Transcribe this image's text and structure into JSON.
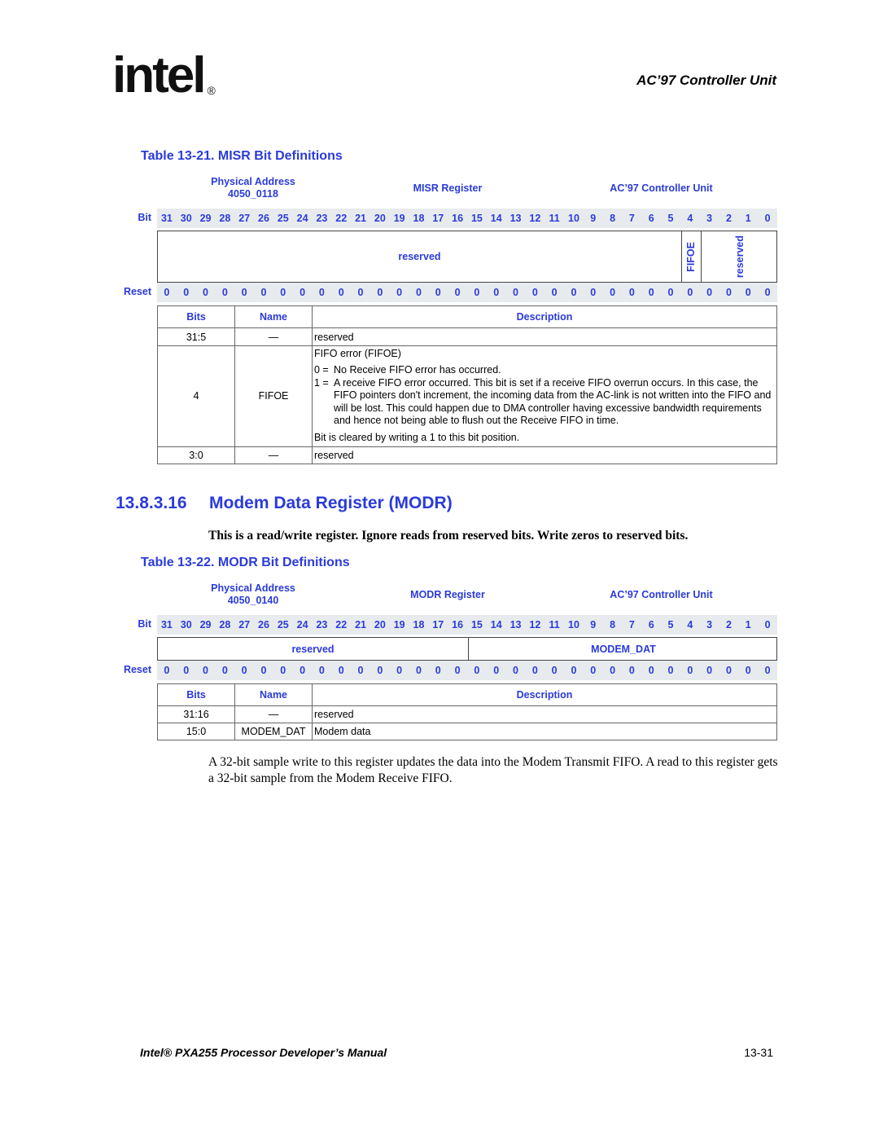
{
  "header": {
    "logo": "intel",
    "logo_mark": "®",
    "chapter": "AC’97 Controller Unit"
  },
  "misr": {
    "table_title": "Table 13-21. MISR Bit Definitions",
    "phys_addr_label": "Physical Address",
    "phys_addr": "4050_0118",
    "register_name": "MISR Register",
    "unit": "AC’97 Controller Unit",
    "bit_label": "Bit",
    "reset_label": "Reset",
    "bits": [
      "31",
      "30",
      "29",
      "28",
      "27",
      "26",
      "25",
      "24",
      "23",
      "22",
      "21",
      "20",
      "19",
      "18",
      "17",
      "16",
      "15",
      "14",
      "13",
      "12",
      "11",
      "10",
      "9",
      "8",
      "7",
      "6",
      "5",
      "4",
      "3",
      "2",
      "1",
      "0"
    ],
    "reset": [
      "0",
      "0",
      "0",
      "0",
      "0",
      "0",
      "0",
      "0",
      "0",
      "0",
      "0",
      "0",
      "0",
      "0",
      "0",
      "0",
      "0",
      "0",
      "0",
      "0",
      "0",
      "0",
      "0",
      "0",
      "0",
      "0",
      "0",
      "0",
      "0",
      "0",
      "0",
      "0"
    ],
    "fields": [
      {
        "name": "reserved",
        "msb": 31,
        "lsb": 5,
        "vertical": false
      },
      {
        "name": "FIFOE",
        "msb": 4,
        "lsb": 4,
        "vertical": true
      },
      {
        "name": "reserved",
        "msb": 3,
        "lsb": 0,
        "vertical": true
      }
    ],
    "columns": {
      "bits": "Bits",
      "name": "Name",
      "description": "Description"
    },
    "rows": [
      {
        "bits": "31:5",
        "name": "—",
        "description": "reserved"
      },
      {
        "bits": "4",
        "name": "FIFOE",
        "desc_title": "FIFO error (FIFOE)",
        "enum": [
          {
            "key": "0 =",
            "text": "No Receive FIFO error has occurred."
          },
          {
            "key": "1 =",
            "text": "A receive FIFO error occurred. This bit is set if a receive FIFO overrun occurs. In this case, the FIFO pointers don't increment, the incoming data from the AC-link is not written into the FIFO and will be lost. This could happen due to DMA controller having excessive bandwidth requirements and hence not being able to flush out the Receive FIFO in time."
          }
        ],
        "desc_note": "Bit is cleared by writing a 1 to this bit position."
      },
      {
        "bits": "3:0",
        "name": "—",
        "description": "reserved"
      }
    ]
  },
  "section": {
    "number": "13.8.3.16",
    "title": "Modem Data Register (MODR)",
    "intro": "This is a read/write register. Ignore reads from reserved bits. Write zeros to reserved bits."
  },
  "modr": {
    "table_title": "Table 13-22. MODR Bit Definitions",
    "phys_addr_label": "Physical Address",
    "phys_addr": "4050_0140",
    "register_name": "MODR Register",
    "unit": "AC’97 Controller Unit",
    "bit_label": "Bit",
    "reset_label": "Reset",
    "bits": [
      "31",
      "30",
      "29",
      "28",
      "27",
      "26",
      "25",
      "24",
      "23",
      "22",
      "21",
      "20",
      "19",
      "18",
      "17",
      "16",
      "15",
      "14",
      "13",
      "12",
      "11",
      "10",
      "9",
      "8",
      "7",
      "6",
      "5",
      "4",
      "3",
      "2",
      "1",
      "0"
    ],
    "reset": [
      "0",
      "0",
      "0",
      "0",
      "0",
      "0",
      "0",
      "0",
      "0",
      "0",
      "0",
      "0",
      "0",
      "0",
      "0",
      "0",
      "0",
      "0",
      "0",
      "0",
      "0",
      "0",
      "0",
      "0",
      "0",
      "0",
      "0",
      "0",
      "0",
      "0",
      "0",
      "0"
    ],
    "fields": [
      {
        "name": "reserved",
        "msb": 31,
        "lsb": 16,
        "vertical": false
      },
      {
        "name": "MODEM_DAT",
        "msb": 15,
        "lsb": 0,
        "vertical": false
      }
    ],
    "columns": {
      "bits": "Bits",
      "name": "Name",
      "description": "Description"
    },
    "rows": [
      {
        "bits": "31:16",
        "name": "—",
        "description": "reserved"
      },
      {
        "bits": "15:0",
        "name": "MODEM_DAT",
        "description": "Modem data"
      }
    ]
  },
  "body_text": "A 32-bit sample write to this register updates the data into the Modem Transmit FIFO. A read to this register gets a 32-bit sample from the Modem Receive FIFO.",
  "footer": {
    "manual": "Intel® PXA255 Processor Developer’s Manual",
    "page": "13-31"
  },
  "colors": {
    "accent": "#2b3bd9",
    "grid_bg": "#e8ebee",
    "border": "#444444"
  }
}
